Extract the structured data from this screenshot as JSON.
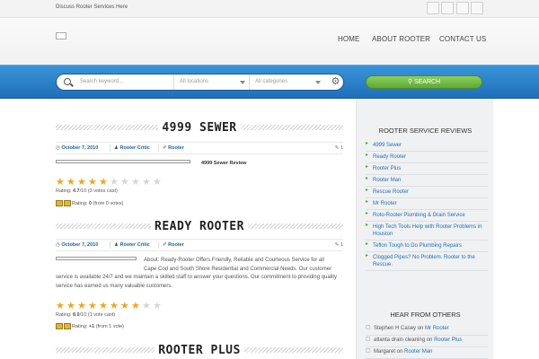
{
  "topbar": {
    "tagline": "Discuss Rooter Services Here"
  },
  "nav": {
    "items": [
      "HOME",
      "ABOUT ROOTER",
      "CONTACT US"
    ]
  },
  "search": {
    "keyword_placeholder": "Search keyword...",
    "locations_placeholder": "All locations",
    "categories_placeholder": "All categories",
    "button_label": "SEARCH"
  },
  "posts": [
    {
      "title": "4999 SEWER",
      "date": "October 7, 2010",
      "author": "Rooter Critic",
      "category": "Rooter",
      "comments": "1",
      "review_label": "4999 Sewer Review",
      "rating_text_prefix": "Rating: ",
      "rating_value": "4.7",
      "rating_max": "/10",
      "rating_votes": " (3 votes cast)",
      "stars_on": 4.5,
      "stars_total": 10,
      "thumbs_prefix": "Rating: ",
      "thumbs_value": "0",
      "thumbs_suffix": " (from 0 votes)"
    },
    {
      "title": "READY ROOTER",
      "date": "October 7, 2010",
      "author": "Rooter Critic",
      "category": "Rooter",
      "comments": "1",
      "excerpt_lines": [
        "About: Ready-Rooter Offers Friendly, Reliable and Courteous Service for all",
        "Cape Cod and South Shore Residential and Commercial Needs. Our customer",
        "service is available 24/7 and we maintain a skilled staff to answer your questions. Our commitment to providing quality",
        "service has earned us many valuable customers."
      ],
      "rating_text_prefix": "Rating: ",
      "rating_value": "8.0",
      "rating_max": "/10",
      "rating_votes": " (1 vote cast)",
      "stars_on": 8,
      "stars_total": 10,
      "thumbs_prefix": "Rating: ",
      "thumbs_value": "+1",
      "thumbs_suffix": " (from 1 vote)"
    },
    {
      "title": "ROOTER PLUS"
    }
  ],
  "sidebar": {
    "reviews_title": "ROOTER SERVICE REVIEWS",
    "reviews": [
      "4999 Sewer",
      "Ready Rooter",
      "Rooter Plus",
      "Rooter Man",
      "Rescue Rooter",
      "Mr Rooter",
      "Roto-Rooter Plumbing & Drain Service",
      "High Tech Tools Help with Rooter Problems in Houston",
      "Teflon Tough to Do Plumbing Repairs",
      "Clogged Pipes? No Problem. Rooter to the Rescue."
    ],
    "hear_title": "HEAR FROM OTHERS",
    "hear": [
      {
        "who": "Stephen H Casey",
        "on": " on ",
        "what": "Mr Rooter"
      },
      {
        "who": "atlanta drain cleaning",
        "on": " on ",
        "what": "Rooter Plus"
      },
      {
        "who": "Margaret",
        "on": " on ",
        "what": "Rooter Man"
      }
    ]
  },
  "colors": {
    "accent_blue": "#1f6fb8",
    "search_green": "#6bb642",
    "star": "#f0a51e"
  }
}
